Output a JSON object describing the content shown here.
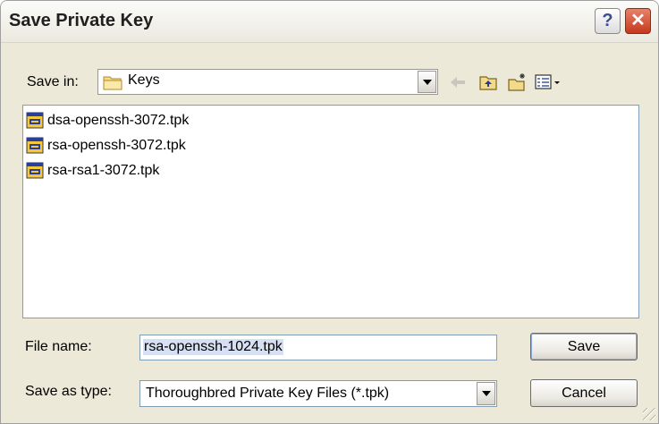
{
  "window": {
    "title": "Save Private Key"
  },
  "titlebar_buttons": {
    "help_glyph": "?",
    "close_glyph": "✕"
  },
  "toolbar": {
    "save_in_label": "Save in:",
    "save_in_value": "Keys",
    "icons": [
      "back-arrow-icon",
      "up-folder-icon",
      "new-folder-icon",
      "view-menu-icon"
    ]
  },
  "files": [
    {
      "name": "dsa-openssh-3072.tpk",
      "icon": "key-file-icon"
    },
    {
      "name": "rsa-openssh-3072.tpk",
      "icon": "key-file-icon"
    },
    {
      "name": "rsa-rsa1-3072.tpk",
      "icon": "key-file-icon"
    }
  ],
  "form": {
    "file_name_label": "File name:",
    "file_name_value": "rsa-openssh-1024.tpk",
    "save_as_type_label": "Save as type:",
    "save_as_type_value": "Thoroughbred Private Key Files (*.tpk)"
  },
  "buttons": {
    "save": "Save",
    "cancel": "Cancel"
  },
  "colors": {
    "close_red": "#c5391c",
    "border_blue": "#7f9db9",
    "dialog_bg": "#ece9d8",
    "selection": "#d7dff2"
  }
}
